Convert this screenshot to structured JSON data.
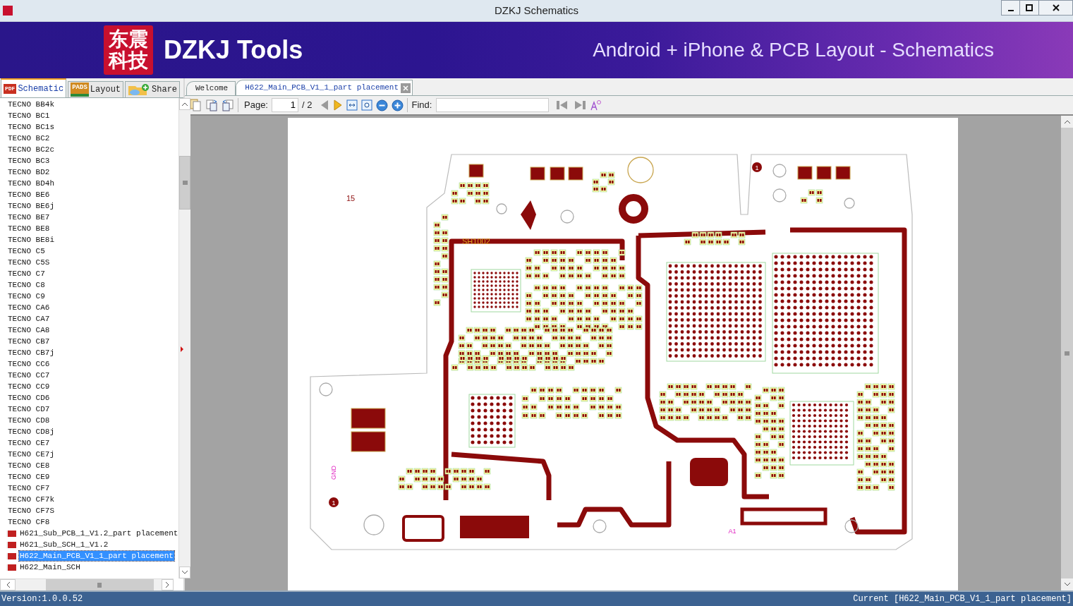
{
  "window": {
    "title": "DZKJ Schematics"
  },
  "banner": {
    "logo_lines": [
      "东震",
      "科技"
    ],
    "brand": "DZKJ Tools",
    "tagline": "Android + iPhone & PCB Layout - Schematics"
  },
  "left_tabs": [
    {
      "label": "Schematic",
      "kind": "pdf",
      "icon_text": "PDF",
      "selected": true
    },
    {
      "label": "Layout",
      "kind": "pads",
      "icon_text": "PADS",
      "selected": false
    },
    {
      "label": "Share",
      "kind": "share",
      "selected": false
    }
  ],
  "doc_tabs": [
    {
      "label": "Welcome",
      "selected": false,
      "closable": false
    },
    {
      "label": "H622_Main_PCB_V1_1_part placement",
      "selected": true,
      "closable": true
    }
  ],
  "toolbar": {
    "page_label": "Page:",
    "page_value": "1",
    "page_total": "/ 2",
    "find_label": "Find:"
  },
  "file_list": [
    {
      "label": "TECNO BB4k",
      "kind": "model",
      "selected": false
    },
    {
      "label": "TECNO BC1",
      "kind": "model",
      "selected": false
    },
    {
      "label": "TECNO BC1s",
      "kind": "model",
      "selected": false
    },
    {
      "label": "TECNO BC2",
      "kind": "model",
      "selected": false
    },
    {
      "label": "TECNO BC2c",
      "kind": "model",
      "selected": false
    },
    {
      "label": "TECNO BC3",
      "kind": "model",
      "selected": false
    },
    {
      "label": "TECNO BD2",
      "kind": "model",
      "selected": false
    },
    {
      "label": "TECNO BD4h",
      "kind": "model",
      "selected": false
    },
    {
      "label": "TECNO BE6",
      "kind": "model",
      "selected": false
    },
    {
      "label": "TECNO BE6j",
      "kind": "model",
      "selected": false
    },
    {
      "label": "TECNO BE7",
      "kind": "model",
      "selected": false
    },
    {
      "label": "TECNO BE8",
      "kind": "model",
      "selected": false
    },
    {
      "label": "TECNO BE8i",
      "kind": "model",
      "selected": false
    },
    {
      "label": "TECNO C5",
      "kind": "model",
      "selected": false
    },
    {
      "label": "TECNO C5S",
      "kind": "model",
      "selected": false
    },
    {
      "label": "TECNO C7",
      "kind": "model",
      "selected": false
    },
    {
      "label": "TECNO C8",
      "kind": "model",
      "selected": false
    },
    {
      "label": "TECNO C9",
      "kind": "model",
      "selected": false
    },
    {
      "label": "TECNO CA6",
      "kind": "model",
      "selected": false
    },
    {
      "label": "TECNO CA7",
      "kind": "model",
      "selected": false
    },
    {
      "label": "TECNO CA8",
      "kind": "model",
      "selected": false
    },
    {
      "label": "TECNO CB7",
      "kind": "model",
      "selected": false
    },
    {
      "label": "TECNO CB7j",
      "kind": "model",
      "selected": false
    },
    {
      "label": "TECNO CC6",
      "kind": "model",
      "selected": false
    },
    {
      "label": "TECNO CC7",
      "kind": "model",
      "selected": false
    },
    {
      "label": "TECNO CC9",
      "kind": "model",
      "selected": false
    },
    {
      "label": "TECNO CD6",
      "kind": "model",
      "selected": false
    },
    {
      "label": "TECNO CD7",
      "kind": "model",
      "selected": false
    },
    {
      "label": "TECNO CD8",
      "kind": "model",
      "selected": false
    },
    {
      "label": "TECNO CD8j",
      "kind": "model",
      "selected": false
    },
    {
      "label": "TECNO CE7",
      "kind": "model",
      "selected": false
    },
    {
      "label": "TECNO CE7j",
      "kind": "model",
      "selected": false
    },
    {
      "label": "TECNO CE8",
      "kind": "model",
      "selected": false
    },
    {
      "label": "TECNO CE9",
      "kind": "model",
      "selected": false
    },
    {
      "label": "TECNO CF7",
      "kind": "model",
      "selected": false
    },
    {
      "label": "TECNO CF7k",
      "kind": "model",
      "selected": false
    },
    {
      "label": "TECNO CF7S",
      "kind": "model",
      "selected": false
    },
    {
      "label": "TECNO CF8",
      "kind": "model",
      "selected": false
    },
    {
      "label": "H621_Sub_PCB_1_V1.2_part placement",
      "kind": "pdf",
      "selected": false
    },
    {
      "label": "H621_Sub_SCH_1_V1.2",
      "kind": "pdf",
      "selected": false
    },
    {
      "label": "H622_Main_PCB_V1_1_part placement",
      "kind": "pdf",
      "selected": true
    },
    {
      "label": "H622_Main_SCH",
      "kind": "pdf",
      "selected": false
    }
  ],
  "pcb_labels": [
    {
      "text": "15",
      "kind": "plain"
    },
    {
      "text": "SH1002",
      "kind": "shield"
    },
    {
      "text": "GND",
      "kind": "net"
    },
    {
      "text": "A1",
      "kind": "net"
    },
    {
      "text": "1",
      "kind": "pin"
    },
    {
      "text": "1",
      "kind": "pin"
    }
  ],
  "status_bar": {
    "version": "Version:1.0.0.52",
    "current": "Current [H622_Main_PCB_V1_1_part placement]"
  }
}
